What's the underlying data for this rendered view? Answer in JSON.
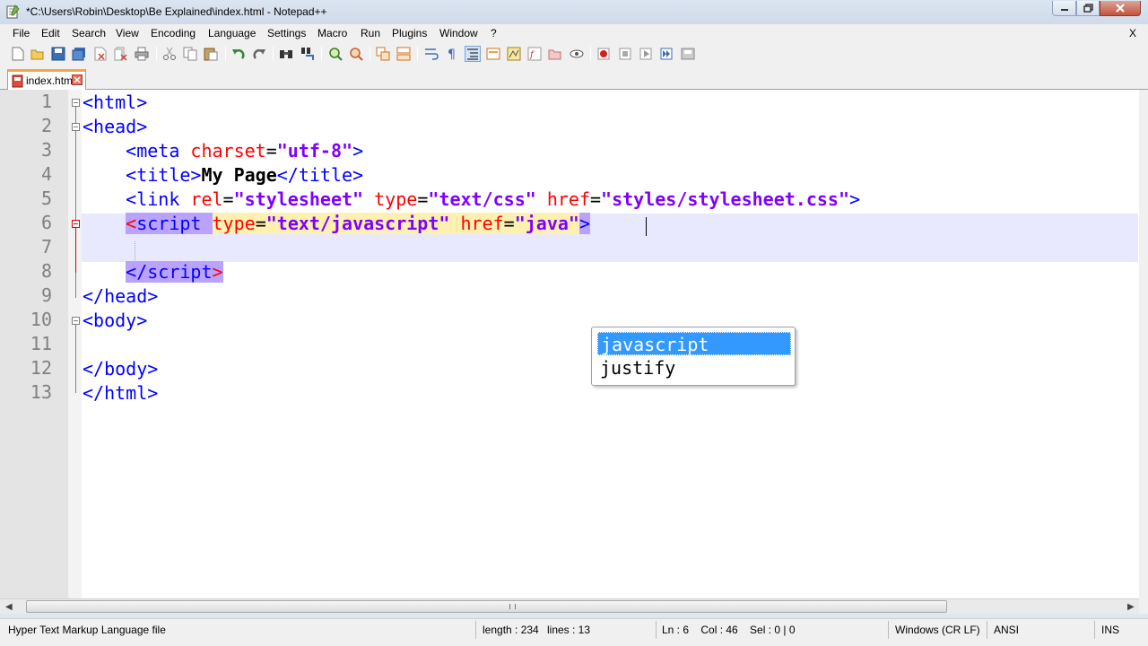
{
  "window": {
    "title": "*C:\\Users\\Robin\\Desktop\\Be Explained\\index.html - Notepad++"
  },
  "menu": {
    "items": [
      "File",
      "Edit",
      "Search",
      "View",
      "Encoding",
      "Language",
      "Settings",
      "Macro",
      "Run",
      "Plugins",
      "Window",
      "?"
    ],
    "close_label": "X"
  },
  "toolbar": {
    "icons": [
      "new-file-icon",
      "open-file-icon",
      "save-icon",
      "save-all-icon",
      "close-icon",
      "close-all-icon",
      "print-icon",
      "cut-icon",
      "copy-icon",
      "paste-icon",
      "undo-icon",
      "redo-icon",
      "find-icon",
      "replace-icon",
      "zoom-in-icon",
      "zoom-out-icon",
      "sync-vertical-icon",
      "sync-horizontal-icon",
      "word-wrap-icon",
      "show-all-chars-icon",
      "indent-guide-icon",
      "user-language-icon",
      "doc-map-icon",
      "function-list-icon",
      "folder-workspace-icon",
      "monitoring-icon",
      "record-macro-icon",
      "stop-record-icon",
      "playback-icon",
      "run-macro-multiple-icon",
      "save-macro-icon"
    ]
  },
  "tabs": [
    {
      "label": "index.html",
      "active": true,
      "modified": true
    }
  ],
  "editor": {
    "line_numbers": [
      "1",
      "2",
      "3",
      "4",
      "5",
      "6",
      "7",
      "8",
      "9",
      "10",
      "11",
      "12",
      "13"
    ],
    "lines": [
      [
        [
          "<html>",
          "t-tag"
        ]
      ],
      [
        [
          "<head>",
          "t-tag"
        ]
      ],
      [
        [
          "    ",
          "t-plain"
        ],
        [
          "<meta ",
          "t-tag"
        ],
        [
          "charset",
          "t-attr"
        ],
        [
          "=",
          "t-plain"
        ],
        [
          "\"utf-8\"",
          "t-val"
        ],
        [
          ">",
          "t-tag"
        ]
      ],
      [
        [
          "    ",
          "t-plain"
        ],
        [
          "<title>",
          "t-tag"
        ],
        [
          "My Page",
          "t-bold"
        ],
        [
          "</title>",
          "t-tag"
        ]
      ],
      [
        [
          "    ",
          "t-plain"
        ],
        [
          "<link ",
          "t-tag"
        ],
        [
          "rel",
          "t-attr"
        ],
        [
          "=",
          "t-plain"
        ],
        [
          "\"stylesheet\"",
          "t-val"
        ],
        [
          " ",
          "t-plain"
        ],
        [
          "type",
          "t-attr"
        ],
        [
          "=",
          "t-plain"
        ],
        [
          "\"text/css\"",
          "t-val"
        ],
        [
          " ",
          "t-plain"
        ],
        [
          "href",
          "t-attr"
        ],
        [
          "=",
          "t-plain"
        ],
        [
          "\"styles/stylesheet.css\"",
          "t-val"
        ],
        [
          ">",
          "t-tag"
        ]
      ],
      [
        [
          "    ",
          "t-plain"
        ],
        [
          "<",
          "t-attr hl-tag"
        ],
        [
          "script",
          "t-tag hl-tag"
        ],
        [
          " ",
          "t-plain hl-tag"
        ],
        [
          "type",
          "t-attr hl-attr"
        ],
        [
          "=",
          "t-plain hl-attr"
        ],
        [
          "\"text/javascript\"",
          "t-val hl-attr"
        ],
        [
          " ",
          "t-plain hl-attr"
        ],
        [
          "href",
          "t-attr hl-attr"
        ],
        [
          "=",
          "t-plain hl-attr"
        ],
        [
          "\"java",
          "t-val hl-attr"
        ],
        [
          "\"",
          "t-val hl-attr"
        ],
        [
          ">",
          "t-tag hl-tag"
        ]
      ],
      [
        [
          "",
          "t-plain"
        ]
      ],
      [
        [
          "    ",
          "t-plain"
        ],
        [
          "</script",
          "t-tag hl-tag"
        ],
        [
          ">",
          "t-attr hl-tag"
        ]
      ],
      [
        [
          "</head>",
          "t-tag"
        ]
      ],
      [
        [
          "<body>",
          "t-tag"
        ]
      ],
      [
        [
          "",
          "t-plain"
        ]
      ],
      [
        [
          "</body>",
          "t-tag"
        ]
      ],
      [
        [
          "</html>",
          "t-tag"
        ]
      ]
    ]
  },
  "autocomplete": {
    "items": [
      "javascript",
      "justify"
    ],
    "selected": 0
  },
  "statusbar": {
    "file_type": "Hyper Text Markup Language file",
    "length": "length : 234",
    "lines": "lines : 13",
    "position": "Ln : 6    Col : 46    Sel : 0 | 0",
    "eol": "Windows (CR LF)",
    "encoding": "ANSI",
    "mode": "INS"
  },
  "colors": {
    "tag": "#0000ff",
    "attribute": "#ff0000",
    "value": "#8000ff",
    "current_line": "#e8e8ff",
    "selection": "#3399ff"
  }
}
